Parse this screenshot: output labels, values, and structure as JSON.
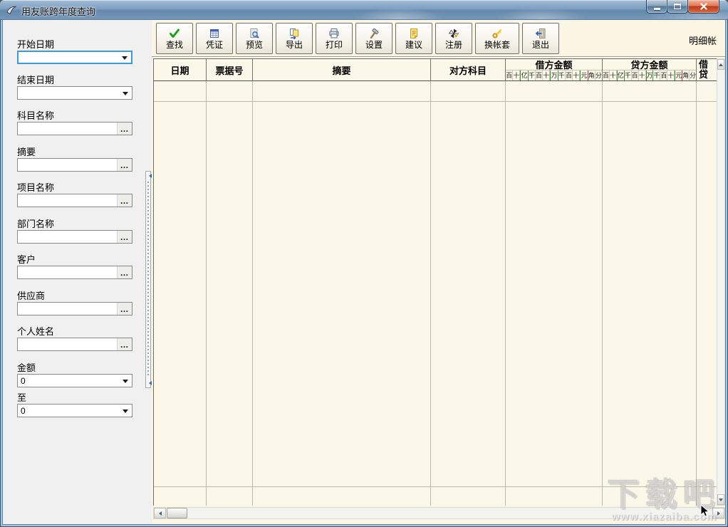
{
  "window": {
    "title": "用友账跨年度查询"
  },
  "ui": {
    "ellipsis_label": "…"
  },
  "sidebar": {
    "fields": [
      {
        "label": "开始日期",
        "type": "combo",
        "value": "",
        "focused": true
      },
      {
        "label": "结束日期",
        "type": "combo",
        "value": "",
        "focused": false
      },
      {
        "label": "科目名称",
        "type": "lookup",
        "value": "",
        "focused": false
      },
      {
        "label": "摘要",
        "type": "lookup",
        "value": "",
        "focused": false
      },
      {
        "label": "项目名称",
        "type": "lookup",
        "value": "",
        "focused": false
      },
      {
        "label": "部门名称",
        "type": "lookup",
        "value": "",
        "focused": false
      },
      {
        "label": "客户",
        "type": "lookup",
        "value": "",
        "focused": false
      },
      {
        "label": "供应商",
        "type": "lookup",
        "value": "",
        "focused": false
      },
      {
        "label": "个人姓名",
        "type": "lookup",
        "value": "",
        "focused": false
      },
      {
        "label": "金额",
        "type": "combo",
        "value": "0",
        "focused": false
      },
      {
        "label": "至",
        "type": "combo",
        "value": "0",
        "focused": false
      }
    ]
  },
  "toolbar": {
    "buttons": [
      {
        "label": "查找",
        "icon": "find-check-icon"
      },
      {
        "label": "凭证",
        "icon": "voucher-icon"
      },
      {
        "label": "预览",
        "icon": "preview-icon"
      },
      {
        "label": "导出",
        "icon": "export-icon"
      },
      {
        "label": "打印",
        "icon": "print-icon"
      },
      {
        "label": "设置",
        "icon": "settings-hammer-icon"
      },
      {
        "label": "建议",
        "icon": "suggestion-note-icon"
      },
      {
        "label": "注册",
        "icon": "register-pinwheel-icon"
      },
      {
        "label": "换帐套",
        "icon": "switch-account-key-icon"
      },
      {
        "label": "退出",
        "icon": "exit-door-icon"
      }
    ],
    "mode_label": "明细帐"
  },
  "table": {
    "columns": [
      "日期",
      "票据号",
      "摘要",
      "对方科目",
      "借方金额",
      "贷方金额"
    ],
    "cross_column": [
      "借",
      "贷"
    ],
    "amount_digits": [
      "百",
      "十",
      "亿",
      "千",
      "百",
      "十",
      "万",
      "千",
      "百",
      "十",
      "元",
      "角",
      "分"
    ],
    "rows": []
  },
  "watermark": {
    "title": "下载吧",
    "url": "www.xiazaiba.com"
  },
  "colors": {
    "focus_border": "#3c9bd5",
    "table_background": "#fcf8e9",
    "grid_line": "#bdbba6",
    "header_line": "#54544c",
    "green_divider": "#2f9a2f",
    "red_divider": "#b03030",
    "close_button_red": "#b83a1c",
    "titlebar_blue": "#7596b8"
  }
}
